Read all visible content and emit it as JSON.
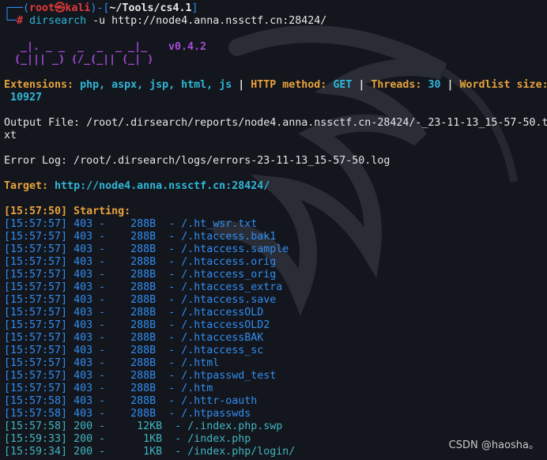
{
  "prompt": {
    "bracket_open": "┌──(",
    "user": "root",
    "at_glyph": "㉿",
    "host": "kali",
    "bracket_mid": ")-[",
    "path": "~/Tools/cs4.1",
    "bracket_close": "]",
    "corner": "└─",
    "hash": "#",
    "command": "dirsearch",
    "args": " -u http://node4.anna.nssctf.cn:28424/"
  },
  "banner": {
    "art1": "  _|. _ _  _  _  _ _|_",
    "art2": " (_||| _) (/_(_|| (_| )",
    "version": "v0.4.2"
  },
  "config": {
    "ext_label": "Extensions: ",
    "ext_value": "php, aspx, jsp, html, js",
    "sep1": " | ",
    "method_label": "HTTP method: ",
    "method_value": "GET",
    "sep2": " | ",
    "threads_label": "Threads: ",
    "threads_value": "30",
    "sep3": " | ",
    "wordlist_label": "Wordlist size:",
    "wordlist_value": " 10927"
  },
  "output_file": {
    "line1": "Output File: /root/.dirsearch/reports/node4.anna.nssctf.cn-28424/-_23-11-13_15-57-50.t",
    "line2": "xt"
  },
  "error_log": "Error Log: /root/.dirsearch/logs/errors-23-11-13_15-57-50.log",
  "target": {
    "label": "Target: ",
    "url": "http://node4.anna.nssctf.cn:28424/"
  },
  "starting": "[15:57:50] Starting: ",
  "results": [
    {
      "time": "[15:57:57]",
      "code": "403",
      "size": "  288B",
      "path": "/.ht_wsr.txt"
    },
    {
      "time": "[15:57:57]",
      "code": "403",
      "size": "  288B",
      "path": "/.htaccess.bak1"
    },
    {
      "time": "[15:57:57]",
      "code": "403",
      "size": "  288B",
      "path": "/.htaccess.sample"
    },
    {
      "time": "[15:57:57]",
      "code": "403",
      "size": "  288B",
      "path": "/.htaccess.orig"
    },
    {
      "time": "[15:57:57]",
      "code": "403",
      "size": "  288B",
      "path": "/.htaccess_orig"
    },
    {
      "time": "[15:57:57]",
      "code": "403",
      "size": "  288B",
      "path": "/.htaccess_extra"
    },
    {
      "time": "[15:57:57]",
      "code": "403",
      "size": "  288B",
      "path": "/.htaccess.save"
    },
    {
      "time": "[15:57:57]",
      "code": "403",
      "size": "  288B",
      "path": "/.htaccessOLD"
    },
    {
      "time": "[15:57:57]",
      "code": "403",
      "size": "  288B",
      "path": "/.htaccessOLD2"
    },
    {
      "time": "[15:57:57]",
      "code": "403",
      "size": "  288B",
      "path": "/.htaccessBAK"
    },
    {
      "time": "[15:57:57]",
      "code": "403",
      "size": "  288B",
      "path": "/.htaccess_sc"
    },
    {
      "time": "[15:57:57]",
      "code": "403",
      "size": "  288B",
      "path": "/.html"
    },
    {
      "time": "[15:57:57]",
      "code": "403",
      "size": "  288B",
      "path": "/.htpasswd_test"
    },
    {
      "time": "[15:57:57]",
      "code": "403",
      "size": "  288B",
      "path": "/.htm"
    },
    {
      "time": "[15:57:58]",
      "code": "403",
      "size": "  288B",
      "path": "/.httr-oauth"
    },
    {
      "time": "[15:57:58]",
      "code": "403",
      "size": "  288B",
      "path": "/.htpasswds"
    },
    {
      "time": "[15:57:58]",
      "code": "200",
      "size": "   12KB",
      "path": "/.index.php.swp"
    },
    {
      "time": "[15:59:33]",
      "code": "200",
      "size": "    1KB",
      "path": "/index.php"
    },
    {
      "time": "[15:59:34]",
      "code": "200",
      "size": "    1KB",
      "path": "/index.php/login/"
    }
  ],
  "watermark": "CSDN @haosha。",
  "colors": {
    "background": "#14161d",
    "prompt_blue": "#2f8df0",
    "prompt_red": "#e03a3a",
    "accent_orange": "#e6a23c",
    "accent_cyan": "#2fb8d8",
    "banner_purple": "#a54ad9"
  }
}
